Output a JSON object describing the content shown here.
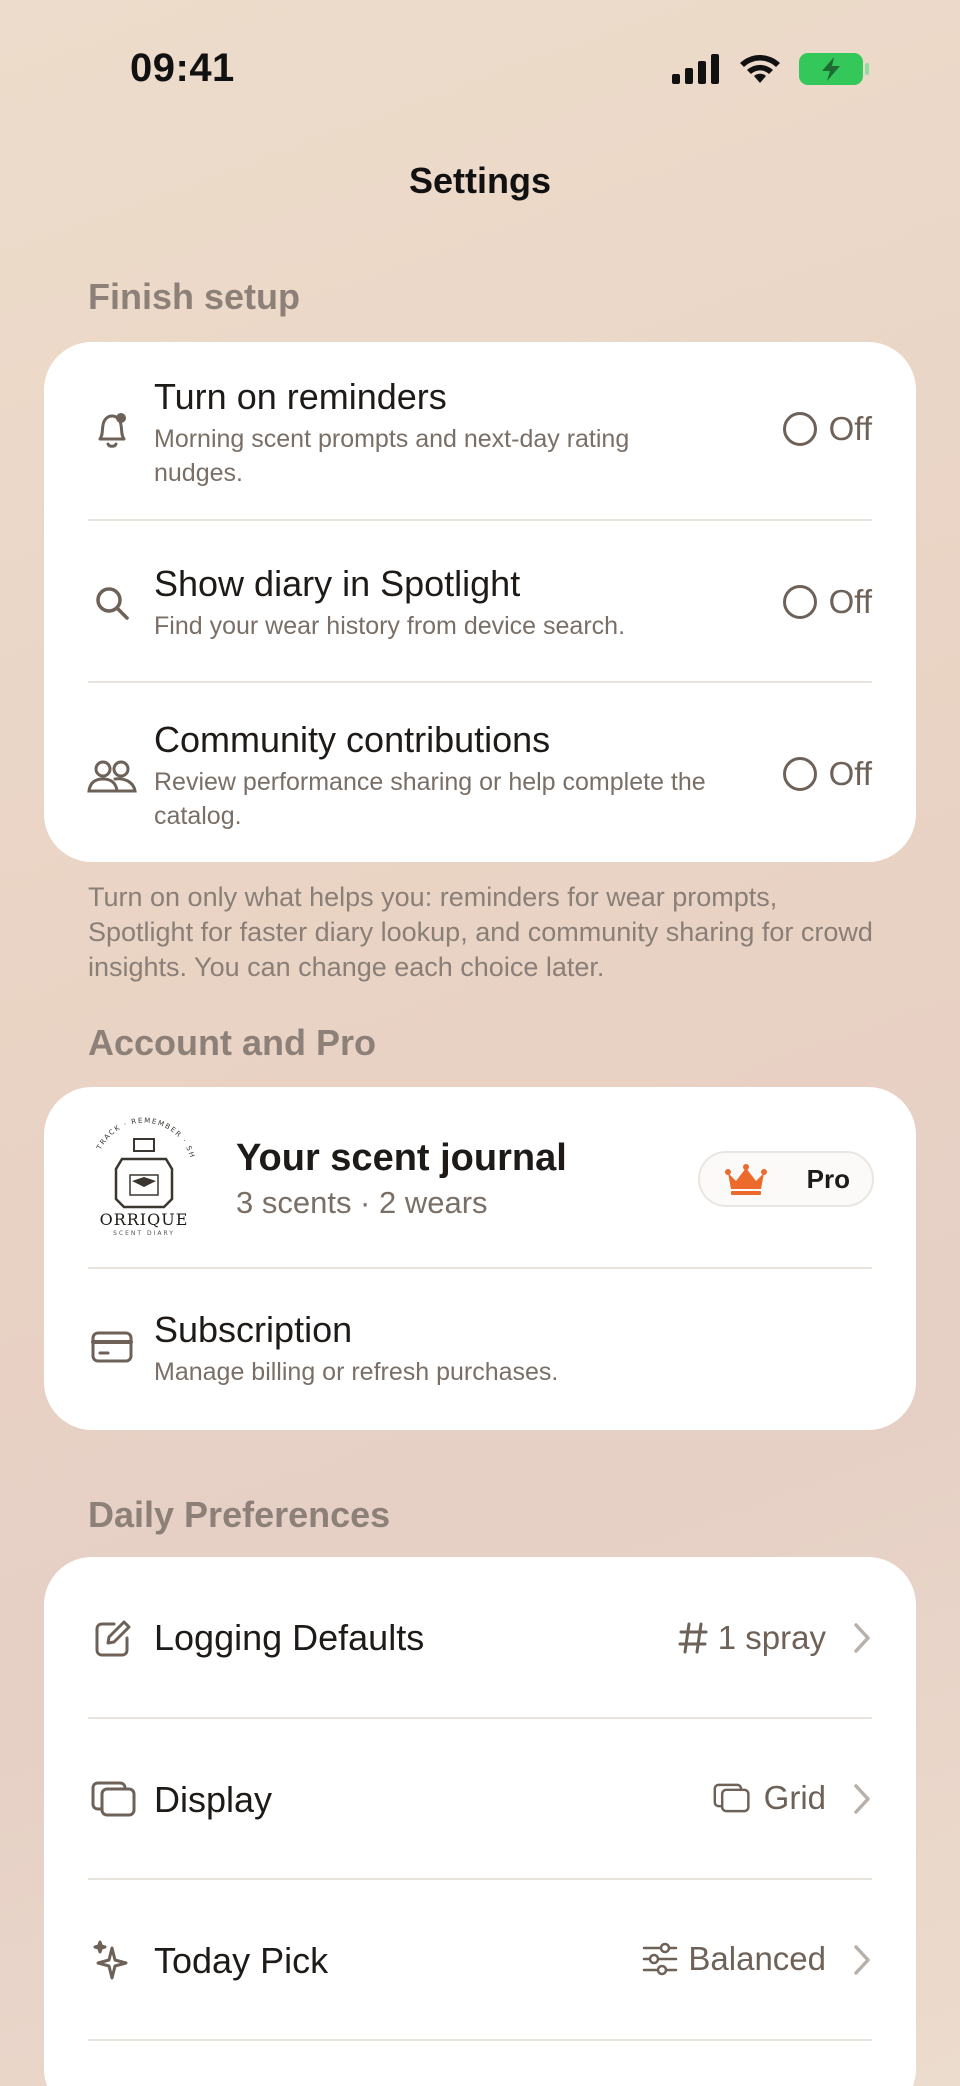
{
  "status": {
    "time": "09:41"
  },
  "nav": {
    "title": "Settings"
  },
  "finish_setup": {
    "title": "Finish setup",
    "items": [
      {
        "title": "Turn on reminders",
        "subtitle": "Morning scent prompts and next-day rating nudges.",
        "icon": "bell-icon",
        "state": "Off"
      },
      {
        "title": "Show diary in Spotlight",
        "subtitle": "Find your wear history from device search.",
        "icon": "search-icon",
        "state": "Off"
      },
      {
        "title": "Community contributions",
        "subtitle": "Review performance sharing or help complete the catalog.",
        "icon": "people-icon",
        "state": "Off"
      }
    ],
    "footnote": "Turn on only what helps you: reminders for wear prompts, Spotlight for faster diary lookup, and community sharing for crowd insights. You can change each choice later."
  },
  "account": {
    "title": "Account and Pro",
    "logo_text": "ORRIQUE",
    "logo_sub": "SCENT DIARY",
    "logo_arc": "TRACK · REMEMBER · SHARE",
    "journal_title": "Your scent journal",
    "journal_sub": "3 scents · 2 wears",
    "badge": "Pro",
    "subscription_title": "Subscription",
    "subscription_sub": "Manage billing or refresh purchases."
  },
  "daily": {
    "title": "Daily Preferences",
    "items": [
      {
        "title": "Logging Defaults",
        "value": "1 spray",
        "icon": "edit-icon",
        "value_icon": "hash-icon"
      },
      {
        "title": "Display",
        "value": "Grid",
        "icon": "layers-icon",
        "value_icon": "layers-icon"
      },
      {
        "title": "Today Pick",
        "value": "Balanced",
        "icon": "sparkle-icon",
        "value_icon": "sliders-icon"
      }
    ]
  },
  "colors": {
    "accent": "#ec6a2c",
    "battery": "#34c759",
    "muted": "#6e6258"
  }
}
